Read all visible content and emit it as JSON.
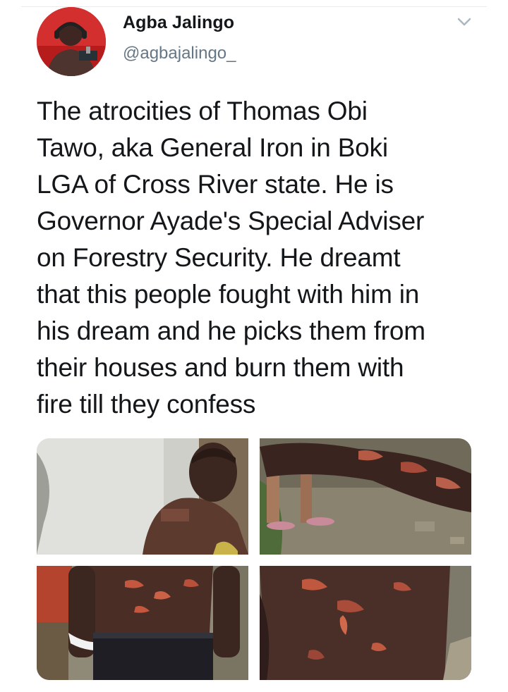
{
  "tweet": {
    "author": {
      "display_name": "Agba Jalingo",
      "handle": "@agbajalingo_"
    },
    "text": "The atrocities of Thomas Obi\nTawo, aka General Iron in Boki\nLGA of Cross River state. He is\nGovernor Ayade's Special Adviser\non Forestry Security. He dreamt\nthat this people fought with him in\nhis dream and he picks them from\ntheir houses and burn them with\nfire till they confess",
    "menu_icon": "chevron-down-icon",
    "media": [
      {
        "icon": "photo"
      },
      {
        "icon": "photo"
      },
      {
        "icon": "photo"
      },
      {
        "icon": "photo"
      }
    ]
  },
  "colors": {
    "text": "#14171a",
    "secondary_text": "#657786",
    "divider": "#e6ecf0",
    "avatar_bg": "#c62828"
  }
}
